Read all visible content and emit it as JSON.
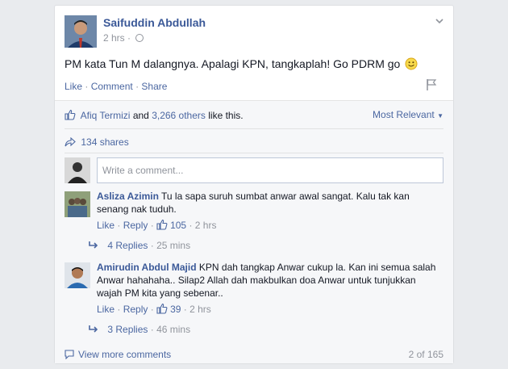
{
  "post": {
    "author": "Saifuddin Abdullah",
    "time": "2 hrs",
    "text": "PM kata Tun M dalangnya. Apalagi KPN, tangkaplah! Go PDRM go",
    "actions": {
      "like": "Like",
      "comment": "Comment",
      "share": "Share"
    }
  },
  "ufi": {
    "liker": "Afiq Termizi",
    "likes_and": "and",
    "likes_others": "3,266 others",
    "likes_suffix": "like this.",
    "sort": "Most Relevant",
    "shares": "134 shares",
    "comment_placeholder": "Write a comment...",
    "view_more": "View more comments",
    "count": "2 of 165"
  },
  "comments": [
    {
      "name": "Asliza Azimin",
      "text": "Tu la sapa suruh sumbat anwar awal sangat. Kalu tak kan senang nak tuduh.",
      "like": "Like",
      "reply": "Reply",
      "likes": "105",
      "time": "2 hrs",
      "replies": "4 Replies",
      "replies_time": "25 mins"
    },
    {
      "name": "Amirudin Abdul Majid",
      "text": "KPN dah tangkap Anwar cukup la. Kan ini semua salah Anwar hahahaha.. Silap2 Allah dah makbulkan doa Anwar untuk tunjukkan wajah PM kita yang sebenar..",
      "like": "Like",
      "reply": "Reply",
      "likes": "39",
      "time": "2 hrs",
      "replies": "3 Replies",
      "replies_time": "46 mins"
    }
  ],
  "icons": {
    "globe": "globe-icon",
    "chevron": "chevron-down-icon",
    "flag": "flag-icon",
    "thumb": "thumbs-up-icon",
    "share": "share-arrow-icon",
    "reply": "reply-arrow-icon",
    "bubble": "comment-bubble-icon",
    "smiley": "smiley-icon"
  },
  "colors": {
    "link": "#4b67a1",
    "name": "#3b5998",
    "meta": "#90949c"
  }
}
